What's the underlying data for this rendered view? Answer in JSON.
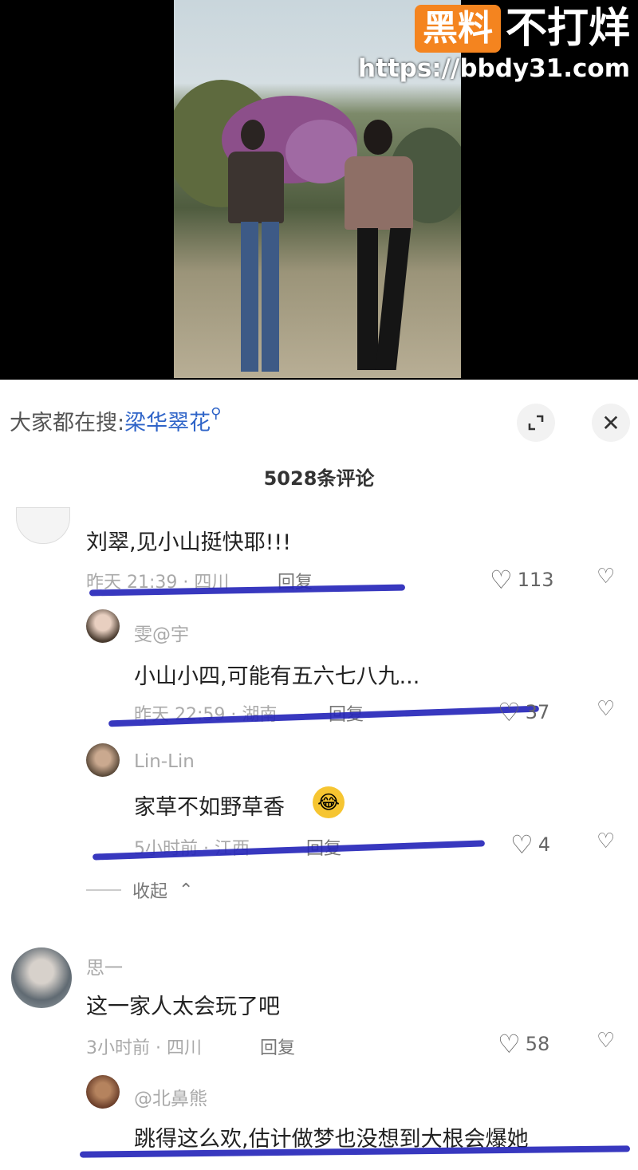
{
  "watermark": {
    "badge": "黑料",
    "text": "不打烊",
    "url": "https://bbdy31.com"
  },
  "search": {
    "label": "大家都在搜:",
    "term": "梁华翠花",
    "icon": "search-icon"
  },
  "comment_count": "5028条评论",
  "comments": [
    {
      "text": "刘翠,见小山挺快耶!!!",
      "meta": "昨天 21:39 · 四川",
      "reply": "回复",
      "likes": "113"
    },
    {
      "name": "雯@宇",
      "text": "小山小四,可能有五六七八九...",
      "meta": "昨天 22:59 · 湖南",
      "reply": "回复",
      "likes": "37"
    },
    {
      "name": "Lin-Lin",
      "text": "家草不如野草香",
      "meta": "5小时前 · 江西",
      "reply": "回复",
      "likes": "4"
    },
    {
      "name": "思一",
      "text": "这一家人太会玩了吧",
      "meta": "3小时前 · 四川",
      "reply": "回复",
      "likes": "58"
    },
    {
      "name": "@北鼻熊",
      "text": "跳得这么欢,估计做梦也没想到大根会爆她"
    }
  ],
  "collapse_label": "收起",
  "colors": {
    "accent_blue": "#2f64c8",
    "scribble": "#2222b8",
    "watermark_orange": "#f4841f"
  }
}
